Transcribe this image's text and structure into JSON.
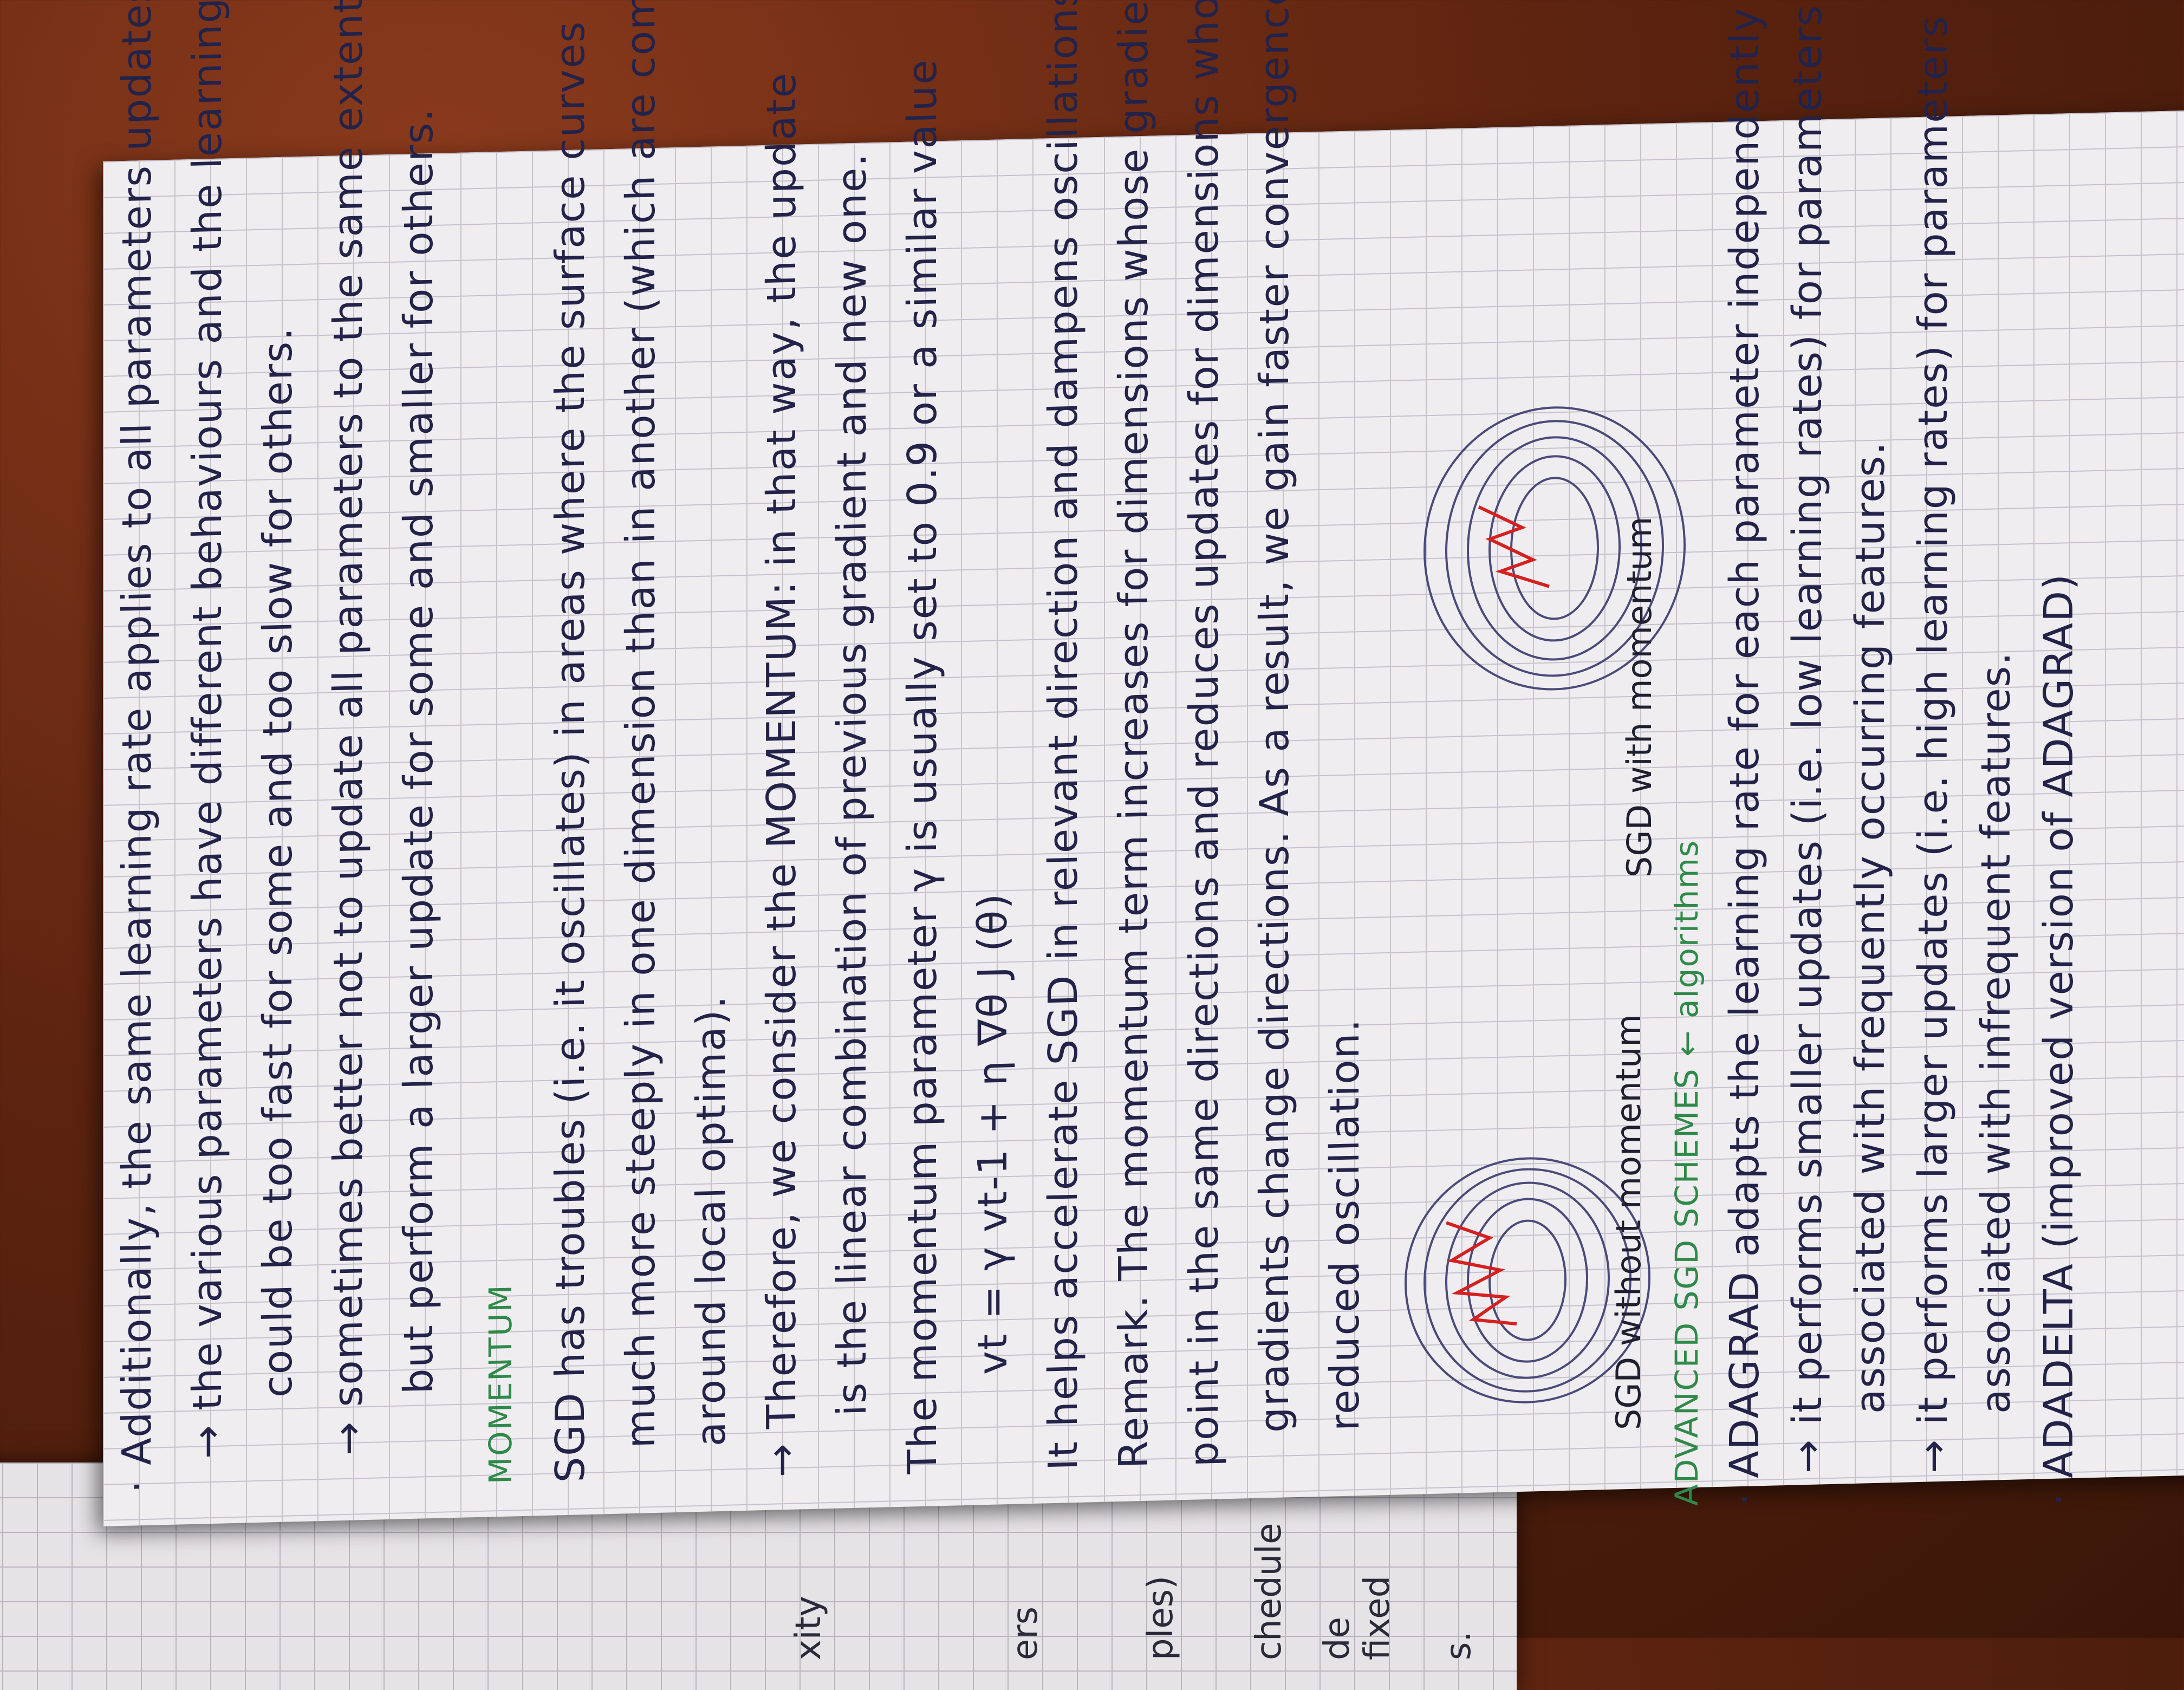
{
  "left_page": {
    "fragments": [
      "xity",
      "ers",
      "ples)",
      "chedule",
      "de fixed",
      "s."
    ]
  },
  "notes": {
    "lines": [
      "· Additionally, the same learning rate applies to all parameters updates",
      "→ the various parameters have different behaviours and the learning rate",
      "could be too fast for some and too slow for others.",
      "→ sometimes better not to update all parameters to the same extent,",
      "but perform a larger update for some and smaller for others.",
      "SGD has troubles (i.e. it oscillates) in areas where the surface curves",
      "much more steeply in one dimension than in another (which are common",
      "around local optima).",
      "→ Therefore, we consider the MOMENTUM: in that way, the update",
      "is the linear combination of previous gradient and new one.",
      "The momentum parameter γ is usually set to 0.9 or a similar value",
      "vt = γ vt-1 + η ∇θ J (θ)",
      "It helps accelerate SGD in relevant direction and dampens oscillations.",
      "Remark. The momentum term increases for dimensions whose gradients",
      "point in the same directions and reduces updates for dimensions whose",
      "gradients change directions. As a result, we gain faster convergence and",
      "reduced oscillation."
    ],
    "momentum_heading": "MOMENTUM",
    "adv_lines": [
      "ADVANCED SGD SCHEMES ← algorithms",
      "· ADAGRAD adapts the learning rate for each parameter independently",
      "→ it performs smaller updates (i.e. low learning rates) for parameters",
      "associated with frequently occurring features.",
      "→ it performs larger updates (i.e. high learning rates) for parameters",
      "associated with infrequent features.",
      "· ADADELTA (improved version of ADAGRAD)"
    ]
  },
  "figures": {
    "left_caption": "SGD without momentum",
    "right_caption": "SGD with momentum"
  }
}
